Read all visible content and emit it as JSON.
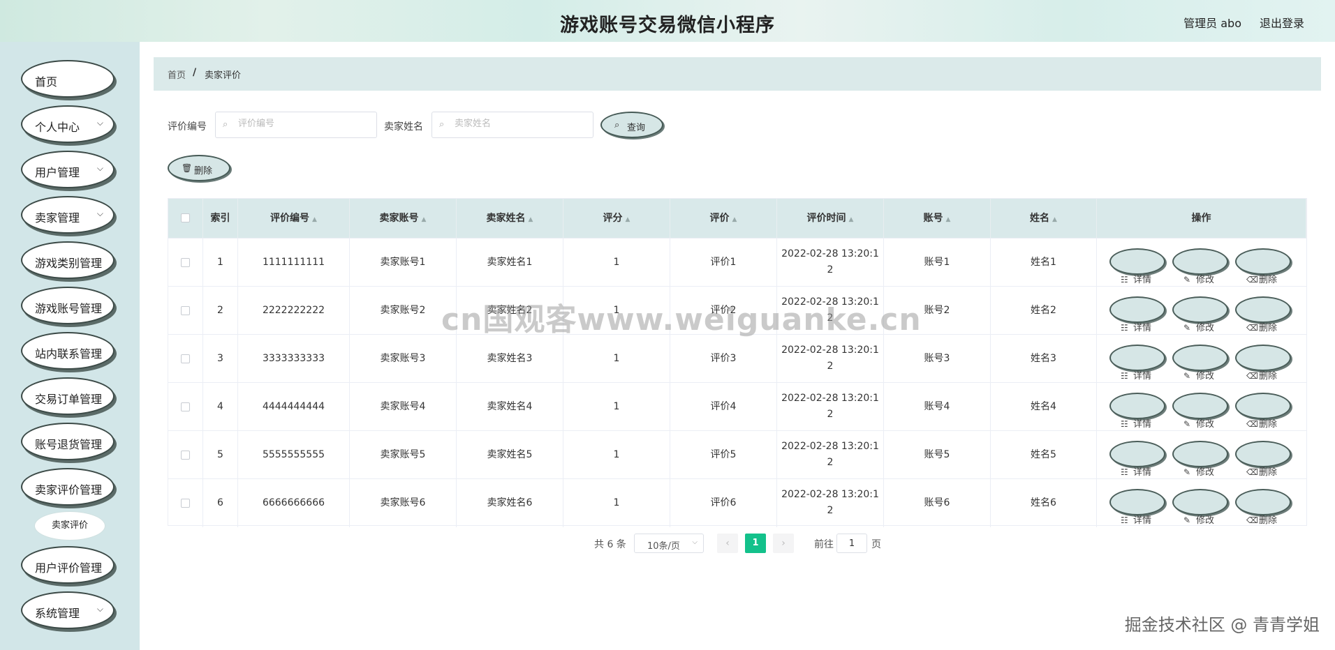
{
  "header": {
    "title": "游戏账号交易微信小程序",
    "admin": "管理员 abo",
    "logout": "退出登录"
  },
  "sidebar": {
    "items": [
      {
        "label": "首页",
        "chevron": false
      },
      {
        "label": "个人中心",
        "chevron": true
      },
      {
        "label": "用户管理",
        "chevron": true
      },
      {
        "label": "卖家管理",
        "chevron": true
      },
      {
        "label": "游戏类别管理",
        "chevron": false
      },
      {
        "label": "游戏账号管理",
        "chevron": false
      },
      {
        "label": "站内联系管理",
        "chevron": false
      },
      {
        "label": "交易订单管理",
        "chevron": false
      },
      {
        "label": "账号退货管理",
        "chevron": false
      },
      {
        "label": "卖家评价管理",
        "chevron": false
      },
      {
        "label": "用户评价管理",
        "chevron": false
      },
      {
        "label": "系统管理",
        "chevron": true
      }
    ],
    "submenu": "卖家评价"
  },
  "breadcrumb": {
    "home": "首页",
    "separator": "/",
    "current": "卖家评价"
  },
  "filters": {
    "f1_label": "评价编号",
    "f1_placeholder": "评价编号",
    "f2_label": "卖家姓名",
    "f2_placeholder": "卖家姓名",
    "query": "查询",
    "delete": "删除"
  },
  "table": {
    "columns": [
      "索引",
      "评价编号",
      "卖家账号",
      "卖家姓名",
      "评分",
      "评价",
      "评价时间",
      "账号",
      "姓名",
      "操作"
    ],
    "rows": [
      [
        "1",
        "1111111111",
        "卖家账号1",
        "卖家姓名1",
        "1",
        "评价1",
        "2022-02-28 13:20:1",
        "2",
        "账号1",
        "姓名1"
      ],
      [
        "2",
        "2222222222",
        "卖家账号2",
        "卖家姓名2",
        "1",
        "评价2",
        "2022-02-28 13:20:1",
        "2",
        "账号2",
        "姓名2"
      ],
      [
        "3",
        "3333333333",
        "卖家账号3",
        "卖家姓名3",
        "1",
        "评价3",
        "2022-02-28 13:20:1",
        "2",
        "账号3",
        "姓名3"
      ],
      [
        "4",
        "4444444444",
        "卖家账号4",
        "卖家姓名4",
        "1",
        "评价4",
        "2022-02-28 13:20:1",
        "2",
        "账号4",
        "姓名4"
      ],
      [
        "5",
        "5555555555",
        "卖家账号5",
        "卖家姓名5",
        "1",
        "评价5",
        "2022-02-28 13:20:1",
        "2",
        "账号5",
        "姓名5"
      ],
      [
        "6",
        "6666666666",
        "卖家账号6",
        "卖家姓名6",
        "1",
        "评价6",
        "2022-02-28 13:20:1",
        "2",
        "账号6",
        "姓名6"
      ]
    ],
    "actions": [
      {
        "label": "详情",
        "icon": "document-icon"
      },
      {
        "label": "修改",
        "icon": "edit-icon"
      },
      {
        "label": "删除",
        "icon": "trash-icon"
      }
    ]
  },
  "pagination": {
    "total": "共 6 条",
    "page_size": "10条/页",
    "current": "1",
    "goto_prefix": "前往",
    "goto_value": "1",
    "goto_suffix": "页"
  },
  "watermark": "cn国观客www.weiguanke.cn",
  "credit": "掘金技术社区 @ 青青学姐",
  "colors": {
    "sidebar": "#d2e6e8",
    "table_header": "#d9e9ea",
    "active_page": "#13c18b"
  }
}
